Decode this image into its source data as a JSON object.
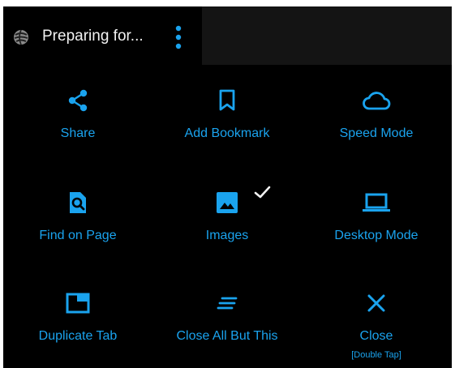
{
  "tab": {
    "title": "Preparing for..."
  },
  "menu": {
    "items": [
      {
        "label": "Share",
        "icon": "share-icon"
      },
      {
        "label": "Add Bookmark",
        "icon": "bookmark-icon"
      },
      {
        "label": "Speed Mode",
        "icon": "cloud-icon"
      },
      {
        "label": "Find on Page",
        "icon": "find-in-page-icon"
      },
      {
        "label": "Images",
        "icon": "image-icon",
        "checked": true
      },
      {
        "label": "Desktop Mode",
        "icon": "laptop-icon"
      },
      {
        "label": "Duplicate Tab",
        "icon": "duplicate-tab-icon"
      },
      {
        "label": "Close All But This",
        "icon": "lines-icon"
      },
      {
        "label": "Close",
        "icon": "close-icon",
        "sublabel": "[Double Tap]"
      }
    ]
  },
  "colors": {
    "accent": "#1aa3ee",
    "background": "#000000",
    "tab_bar_inactive": "#141414",
    "text": "#f2f2f2"
  }
}
